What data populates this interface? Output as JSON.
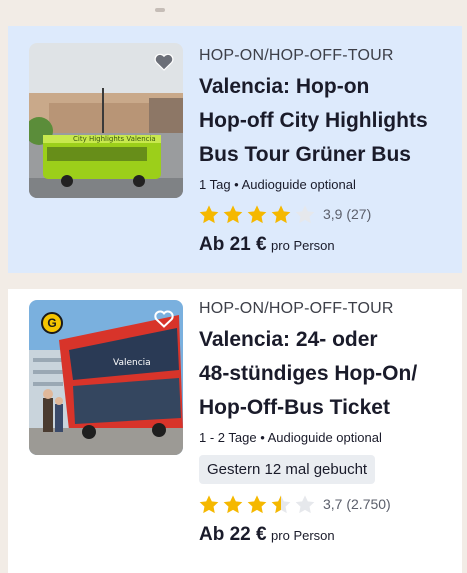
{
  "tours": [
    {
      "category": "HOP-ON/HOP-OFF-TOUR",
      "title_lines": [
        "Valencia: Hop-on",
        "Hop-off City Highlights",
        "Bus Tour Grüner Bus"
      ],
      "meta": "1 Tag • Audioguide optional",
      "rating": 3.9,
      "rating_text": "3,9 (27)",
      "price_from": "Ab 21 €",
      "price_per": "pro Person",
      "favorite_icon": "heart-filled-icon",
      "image_text": "City Highlights Valencia",
      "colors": {
        "card_bg": "#ddeafc",
        "star": "#f5b800"
      }
    },
    {
      "category": "HOP-ON/HOP-OFF-TOUR",
      "title_lines": [
        "Valencia: 24- oder",
        "48-stündiges Hop-On/",
        "Hop-Off-Bus Ticket"
      ],
      "meta": "1 - 2 Tage • Audioguide optional",
      "booked": "Gestern 12 mal gebucht",
      "rating": 3.7,
      "rating_text": "3,7 (2.750)",
      "price_from": "Ab 22 €",
      "price_per": "pro Person",
      "favorite_icon": "heart-outline-icon",
      "badge": "G",
      "image_text": "Valencia",
      "colors": {
        "card_bg": "#ffffff",
        "star": "#f5b800"
      }
    }
  ]
}
